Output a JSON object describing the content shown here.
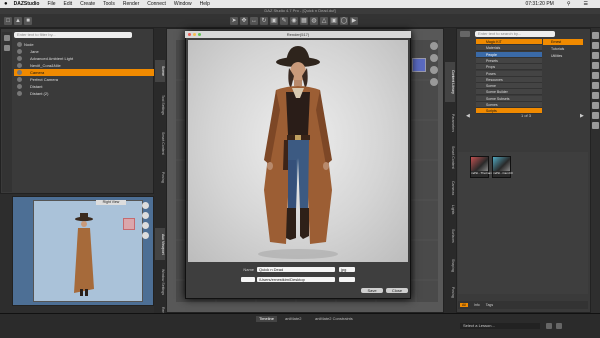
{
  "menubar": {
    "app_name": "DAZStudio",
    "items": [
      "File",
      "Edit",
      "Create",
      "Tools",
      "Render",
      "Connect",
      "Window",
      "Help"
    ],
    "clock": "07:31:20 PM"
  },
  "window": {
    "title": "DAZ Studio 4.7 Pro - [Quick n Dead.duf]"
  },
  "scene": {
    "search_placeholder": "Enter text to filter by...",
    "tab_scene": "Scene",
    "tab_content_library": "Content Library",
    "tab_shaping": "Shaping",
    "tab_posing": "Posing",
    "tab_tool_settings": "Tool Settings",
    "tab_aux_viewport": "Aux Viewport",
    "tab_window_settings": "Window Settings",
    "tab_render_settings": "Render Settings",
    "tree": [
      {
        "label": "Node",
        "indent": 0,
        "selected": false
      },
      {
        "label": "Jane",
        "indent": 1,
        "selected": false
      },
      {
        "label": "Advanced Ambient Light",
        "indent": 1,
        "selected": false
      },
      {
        "label": "Neviñ_Cora&Nile",
        "indent": 1,
        "selected": false
      },
      {
        "label": "Camera",
        "indent": 1,
        "selected": true
      },
      {
        "label": "Perfect Camera",
        "indent": 1,
        "selected": false
      },
      {
        "label": "Distant",
        "indent": 1,
        "selected": false
      },
      {
        "label": "Distant (2)",
        "indent": 1,
        "selected": false
      }
    ]
  },
  "aux_viewport": {
    "camera_label": "Right View"
  },
  "render_window": {
    "title": "Render(517)",
    "name_label": "Name",
    "name_value": "Quick n Dead",
    "format_value": "jpg",
    "path_value": "/Users/ernestkim/Desktop",
    "save_button": "Save",
    "close_button": "Close"
  },
  "content_library": {
    "search_placeholder": "Enter text to search by...",
    "categories": [
      {
        "label": "Magic KIT",
        "state": "sel"
      },
      {
        "label": "Materials",
        "state": ""
      },
      {
        "label": "People",
        "state": "hl"
      },
      {
        "label": "Presets",
        "state": ""
      },
      {
        "label": "Props",
        "state": ""
      },
      {
        "label": "Poses",
        "state": ""
      },
      {
        "label": "Resources",
        "state": ""
      },
      {
        "label": "Scene",
        "state": ""
      },
      {
        "label": "Scene Builder",
        "state": ""
      },
      {
        "label": "Scene Subsets",
        "state": ""
      },
      {
        "label": "Scenes",
        "state": ""
      },
      {
        "label": "Scripts",
        "state": "sel"
      }
    ],
    "subcategories": [
      {
        "label": "Ernest",
        "state": "sel"
      },
      {
        "label": "Tutorials",
        "state": ""
      },
      {
        "label": "Utilities",
        "state": ""
      }
    ],
    "page_info": "1 of 3",
    "thumbs": [
      {
        "caption": "mdSt...TheCam"
      },
      {
        "caption": "mdSt...CamC0"
      }
    ],
    "bottom_tabs": [
      "All",
      "Info",
      "Tags"
    ]
  },
  "right_tabs": [
    "Content Library",
    "Smart Content",
    "Lights",
    "Surfaces",
    "Cameras",
    "Parameters",
    "Shaping",
    "Posing"
  ],
  "bottom": {
    "tabs": [
      "Timeline",
      "aniMate2",
      "aniMate2 Constraints"
    ],
    "lesson_placeholder": "Select a Lesson..."
  },
  "colors": {
    "accent": "#f08a00",
    "highlight": "#3a6aa8",
    "viewport_bg": "#4d6f95"
  }
}
